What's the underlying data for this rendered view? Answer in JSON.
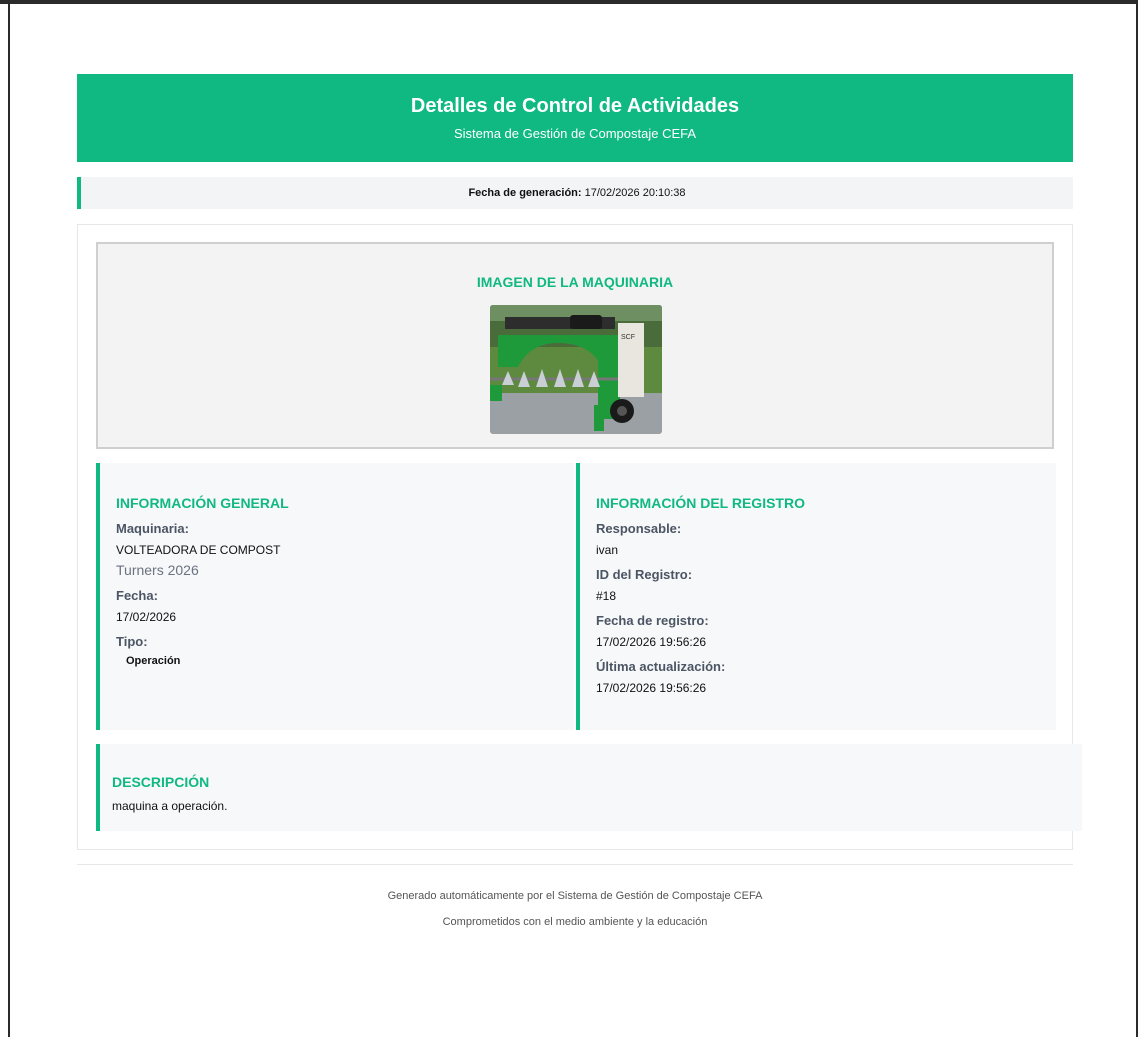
{
  "header": {
    "title": "Detalles de Control de Actividades",
    "subtitle": "Sistema de Gestión de Compostaje CEFA"
  },
  "generation": {
    "label": "Fecha de generación:",
    "value": "17/02/2026 20:10:38"
  },
  "image_section": {
    "title": "IMAGEN DE LA MAQUINARIA",
    "machine_plate": "SCF"
  },
  "general_info": {
    "title": "INFORMACIÓN GENERAL",
    "machine_label": "Maquinaria:",
    "machine_value": "VOLTEADORA DE COMPOST",
    "machine_model": "Turners 2026",
    "date_label": "Fecha:",
    "date_value": "17/02/2026",
    "type_label": "Tipo:",
    "type_value": "Operación"
  },
  "record_info": {
    "title": "INFORMACIÓN DEL REGISTRO",
    "responsible_label": "Responsable:",
    "responsible_value": "ivan",
    "id_label": "ID del Registro:",
    "id_value": "#18",
    "record_date_label": "Fecha de registro:",
    "record_date_value": "17/02/2026 19:56:26",
    "updated_label": "Última actualización:",
    "updated_value": "17/02/2026 19:56:26"
  },
  "description": {
    "title": "DESCRIPCIÓN",
    "text": "maquina a operación."
  },
  "footer": {
    "line1": "Generado automáticamente por el Sistema de Gestión de Compostaje CEFA",
    "line2": "Comprometidos con el medio ambiente y la educación"
  },
  "colors": {
    "accent": "#10b981",
    "panel": "#f7f8fa"
  }
}
